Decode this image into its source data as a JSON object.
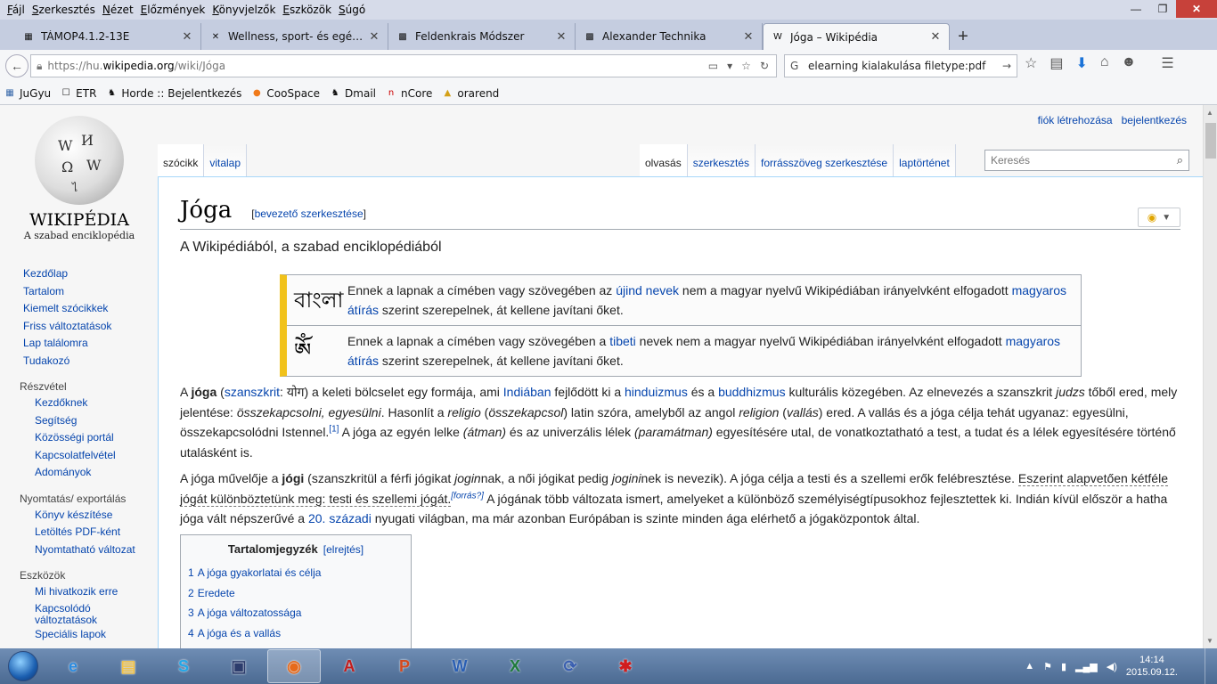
{
  "menubar": {
    "items": [
      {
        "label": "Fájl",
        "accel": "F",
        "rest": "ájl"
      },
      {
        "label": "Szerkesztés",
        "accel": "S",
        "rest": "zerkesztés"
      },
      {
        "label": "Nézet",
        "accel": "N",
        "rest": "ézet"
      },
      {
        "label": "Előzmények",
        "accel": "E",
        "rest": "lőzmények"
      },
      {
        "label": "Könyvjelzők",
        "accel": "K",
        "rest": "önyvjelzők"
      },
      {
        "label": "Eszközök",
        "accel": "E",
        "rest": "szközök"
      },
      {
        "label": "Súgó",
        "accel": "S",
        "rest": "úgó"
      }
    ]
  },
  "tabs": [
    {
      "title": "TÁMOP4.1.2-13E",
      "icon": "pma-icon",
      "active": false
    },
    {
      "title": "Wellness, sport- és egészs...",
      "icon": "wellness-icon",
      "active": false
    },
    {
      "title": "Feldenkrais Módszer",
      "icon": "site-icon",
      "active": false
    },
    {
      "title": "Alexander Technika",
      "icon": "site-icon",
      "active": false
    },
    {
      "title": "Jóga – Wikipédia",
      "icon": "wikipedia-w-icon",
      "active": true
    }
  ],
  "navbar": {
    "url_prefix": "https://hu.",
    "url_host": "wikipedia.org",
    "url_path": "/wiki/Jóga",
    "search_value": "elearning kialakulása filetype:pdf"
  },
  "bookmarks": [
    {
      "label": "JuGyu",
      "icon": "grid-icon"
    },
    {
      "label": "ETR",
      "icon": "blank-page-icon"
    },
    {
      "label": "Horde :: Bejelentkezés",
      "icon": "horde-icon"
    },
    {
      "label": "CooSpace",
      "icon": "coospace-icon"
    },
    {
      "label": "Dmail",
      "icon": "dmail-icon"
    },
    {
      "label": "nCore",
      "icon": "ncore-icon"
    },
    {
      "label": "orarend",
      "icon": "pma-icon"
    }
  ],
  "wiki": {
    "wordmark": "WIKIPÉDIA",
    "tagline": "A szabad enciklopédia",
    "user_links": [
      "fiók létrehozása",
      "bejelentkezés"
    ],
    "nav": [
      "Kezdőlap",
      "Tartalom",
      "Kiemelt szócikkek",
      "Friss változtatások",
      "Lap találomra",
      "Tudakozó"
    ],
    "portals": [
      {
        "heading": "Részvétel",
        "links": [
          "Kezdőknek",
          "Segítség",
          "Közösségi portál",
          "Kapcsolatfelvétel",
          "Adományok"
        ]
      },
      {
        "heading": "Nyomtatás/ exportálás",
        "links": [
          "Könyv készítése",
          "Letöltés PDF-ként",
          "Nyomtatható változat"
        ]
      },
      {
        "heading": "Eszközök",
        "links": [
          "Mi hivatkozik erre",
          "Kapcsolódó változtatások",
          "Speciális lapok"
        ]
      }
    ],
    "left_tabs": [
      "szócikk",
      "vitalap"
    ],
    "right_tabs": [
      "olvasás",
      "szerkesztés",
      "forrásszöveg szerkesztése",
      "laptörténet"
    ],
    "search_placeholder": "Keresés",
    "title": "Jóga",
    "edit_lead": "bevezető szerkesztése",
    "from_line": "A Wikipédiából, a szabad enciklopédiából",
    "ambox": [
      {
        "glyph": "বাংলা",
        "t1": "Ennek a lapnak a címében vagy szövegében az ",
        "l1": "újind nevek",
        "t2": " nem a magyar nyelvű Wikipédiában irányelvként elfogadott ",
        "l2": "magyaros átírás",
        "t3": " szerint szerepelnek, át kellene javítani őket."
      },
      {
        "glyph": "ༀ",
        "t1": "Ennek a lapnak a címében vagy szövegében a ",
        "l1": "tibeti",
        "t2": " nevek nem a magyar nyelvű Wikipédiában irányelvként elfogadott ",
        "l2": "magyaros átírás",
        "t3": " szerint szerepelnek, át kellene javítani őket."
      }
    ],
    "p1": {
      "a": "A ",
      "b": "jóga",
      "c": " (",
      "d": "szanszkrit",
      "e": ": योग) a keleti bölcselet egy formája, ami ",
      "f": "Indiában",
      "g": " fejlődött ki a ",
      "h": "hinduizmus",
      "i": " és a ",
      "j": "buddhizmus",
      "k": " kulturális közegében. Az elnevezés a szanszkrit ",
      "l": "judzs",
      "m": " tőből ered, mely jelentése: ",
      "n": "összekapcsolni, egyesülni",
      "o": ". Hasonlít a ",
      "p": "religio",
      "q": " (",
      "r": "összekapcsol",
      "s": ") latin szóra, amelyből az angol ",
      "t": "religion",
      "u": " (",
      "v": "vallás",
      "w": ") ered. A vallás és a jóga célja tehát ugyanaz: egyesülni, összekapcsolódni Istennel.",
      "ref": "[1]",
      "x": " A jóga az egyén lelke ",
      "y": "(átman)",
      "z": " és az univerzális lélek ",
      "aa": "(paramátman)",
      "ab": " egyesítésére utal, de vonatkoztatható a test, a tudat és a lélek egyesítésére történő utalásként is."
    },
    "p2": {
      "a": "A jóga művelője a ",
      "b": "jógi",
      "c": " (szanszkritül a férfi jógikat ",
      "d": "jogin",
      "e": "nak, a női jógikat pedig ",
      "f": "jogini",
      "g": "nek is nevezik). A jóga célja a testi és a szellemi erők felébresztése. ",
      "h": "Eszerint alapvetően kétféle jógát különböztetünk meg: testi és szellemi jógát.",
      "ref": "[forrás?]",
      "i": " A jógának több változata ismert, amelyeket a különböző személyiségtípusokhoz fejlesztettek ki. Indián kívül először a hatha jóga vált népszerűvé a ",
      "j": "20. századi",
      "k": " nyugati világban, ma már azonban Európában is szinte minden ága elérhető a jógaközpontok által."
    },
    "toc": {
      "title": "Tartalomjegyzék",
      "toggle": "[elrejtés]",
      "items": [
        {
          "num": "1",
          "label": "A jóga gyakorlatai és célja"
        },
        {
          "num": "2",
          "label": "Eredete"
        },
        {
          "num": "3",
          "label": "A jóga változatossága"
        },
        {
          "num": "4",
          "label": "A jóga és a vallás"
        }
      ]
    }
  },
  "taskbar": {
    "apps": [
      {
        "name": "ie-icon",
        "glyph": "e",
        "color": "#2a8be0"
      },
      {
        "name": "explorer-folder-icon",
        "glyph": "▤",
        "color": "#f0c24b"
      },
      {
        "name": "skype-icon",
        "glyph": "S",
        "color": "#22a7e8"
      },
      {
        "name": "floppy-save-icon",
        "glyph": "▣",
        "color": "#2c3c6c"
      },
      {
        "name": "firefox-icon",
        "glyph": "◉",
        "color": "#e66a1b"
      },
      {
        "name": "acrobat-icon",
        "glyph": "A",
        "color": "#c21d1d"
      },
      {
        "name": "powerpoint-icon",
        "glyph": "P",
        "color": "#d2491f"
      },
      {
        "name": "word-icon",
        "glyph": "W",
        "color": "#2b5fb3"
      },
      {
        "name": "excel-icon",
        "glyph": "X",
        "color": "#1f7a3c"
      },
      {
        "name": "sync-icon",
        "glyph": "⟳",
        "color": "#3a5fb0"
      },
      {
        "name": "paint-splat-icon",
        "glyph": "✱",
        "color": "#d11d1d"
      }
    ],
    "time": "14:14",
    "date": "2015.09.12."
  }
}
